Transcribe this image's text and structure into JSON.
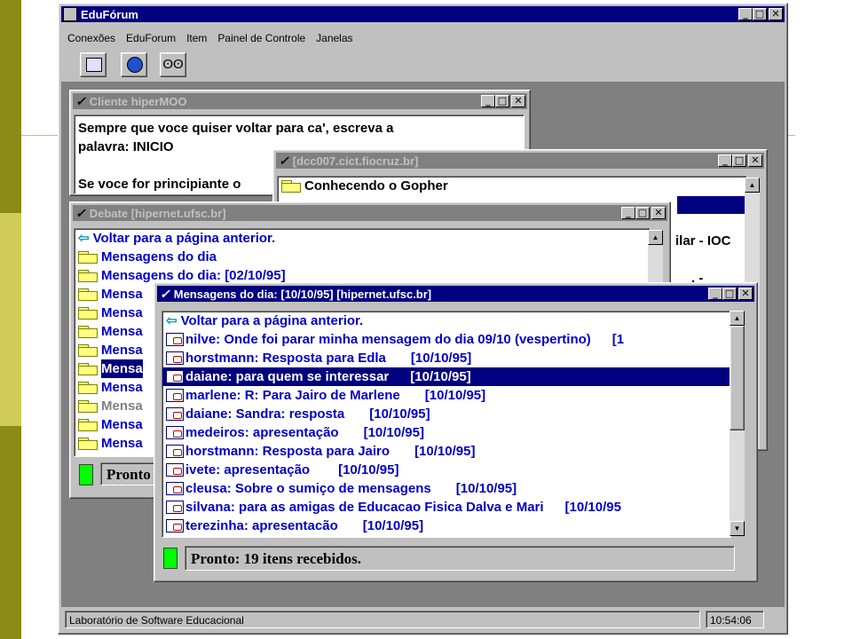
{
  "slide_colors": {
    "left_stripe": "#8b8b17",
    "accent_light": "#d0cc5a"
  },
  "app": {
    "title": "EduFórum",
    "menu": [
      "Conexões",
      "EduForum",
      "Item",
      "Painel de Controle",
      "Janelas"
    ],
    "toolbar_icons": [
      "network-icon",
      "globe-icon",
      "glasses-icon"
    ],
    "statusbar": {
      "left": "Laboratório de Software Educacional",
      "time": "10:54:06"
    }
  },
  "win_moo": {
    "title": "Cliente hiperMOO",
    "lines": [
      "Sempre que voce quiser voltar para ca', escreva  a",
      "palavra: INICIO",
      "",
      "Se voce for principiante o"
    ]
  },
  "win_gopher": {
    "title": "[dcc007.cict.fiocruz.br]",
    "first_item": "Conhecendo o Gopher",
    "partial_text_1": "ilar - IOC",
    "partial_text_2": ". -"
  },
  "win_debate": {
    "title": "Debate [hipernet.ufsc.br]",
    "back": "Voltar para a página anterior.",
    "items": [
      "Mensagens do dia",
      "Mensagens do dia: [02/10/95]",
      "Mensa",
      "Mensa",
      "Mensa",
      "Mensa",
      "Mensa",
      "Mensa",
      "Mensa",
      "Mensa",
      "Mensa"
    ],
    "status": "Pronto"
  },
  "win_msgs": {
    "title": "Mensagens do dia: [10/10/95] [hipernet.ufsc.br]",
    "back": "Voltar para a página anterior.",
    "items": [
      {
        "text": "nilve:  Onde foi parar minha mensagem do dia 09/10 (vespertino)",
        "date": "[1"
      },
      {
        "text": "horstmann: Resposta para  Edla",
        "date": "[10/10/95]"
      },
      {
        "text": "daiane: para quem se interessar",
        "date": "[10/10/95]"
      },
      {
        "text": "marlene: R: Para Jairo de Marlene",
        "date": "[10/10/95]"
      },
      {
        "text": "daiane: Sandra: resposta",
        "date": "[10/10/95]"
      },
      {
        "text": "medeiros: apresentação",
        "date": "[10/10/95]"
      },
      {
        "text": "horstmann: Resposta para  Jairo",
        "date": "[10/10/95]"
      },
      {
        "text": "ivete: apresentação",
        "date": "[10/10/95]"
      },
      {
        "text": "cleusa: Sobre o sumiço de mensagens",
        "date": "[10/10/95]"
      },
      {
        "text": "silvana: para as amigas de Educacao Fisica Dalva e Mari",
        "date": "[10/10/95"
      },
      {
        "text": "terezinha: apresentacão",
        "date": "[10/10/95]"
      }
    ],
    "status": "Pronto: 19  itens recebidos."
  }
}
